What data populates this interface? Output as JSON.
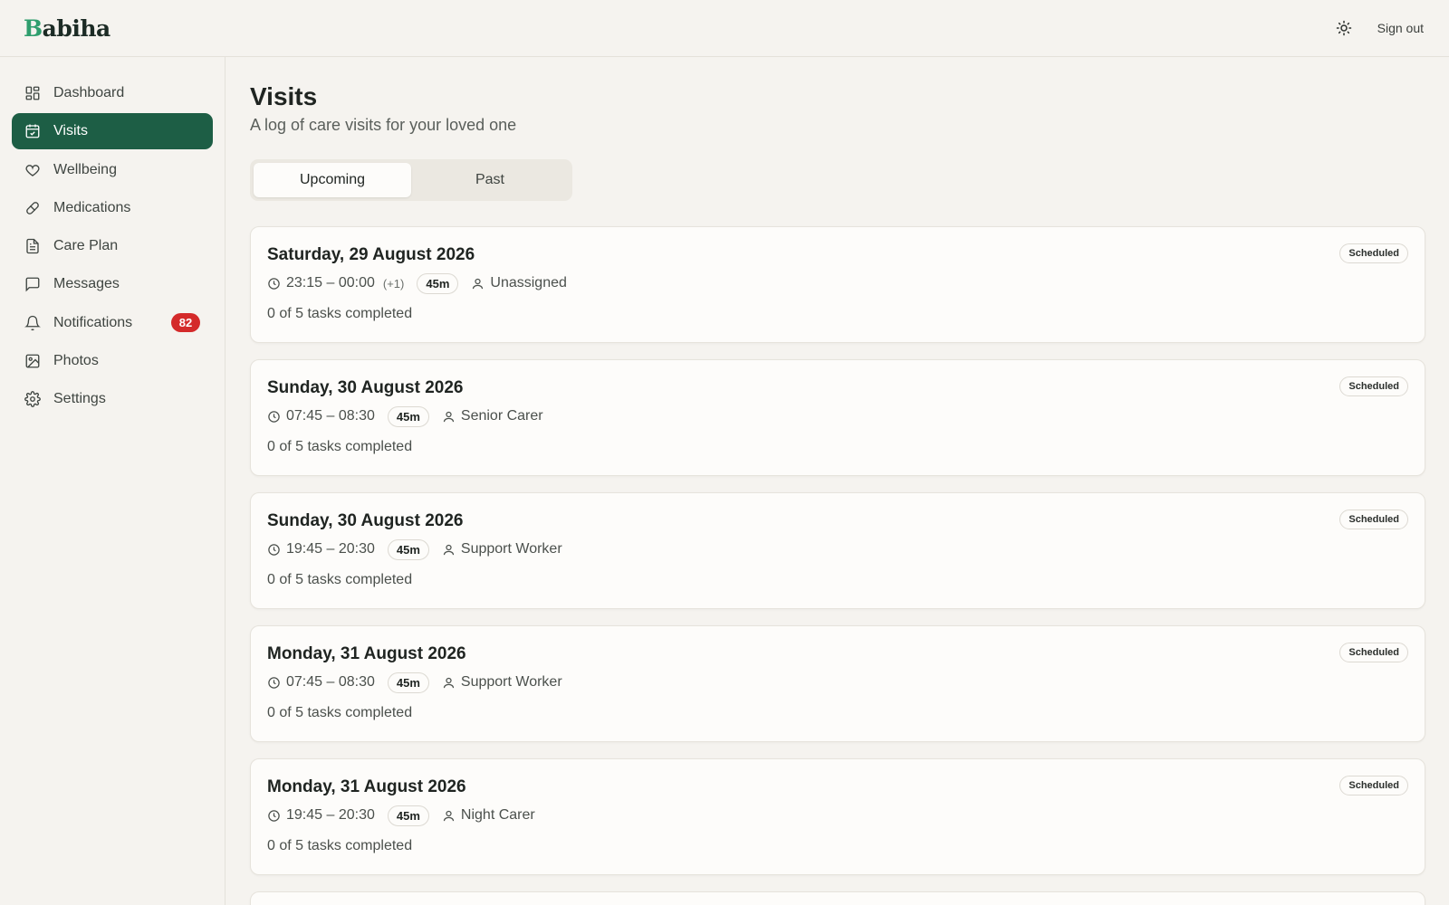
{
  "app": {
    "logo_first": "B",
    "logo_rest": "abiha",
    "sign_out": "Sign out",
    "theme_icon": "sun-icon"
  },
  "sidebar": {
    "items": [
      {
        "label": "Dashboard",
        "icon": "dashboard-icon"
      },
      {
        "label": "Visits",
        "icon": "calendar-icon",
        "active": true
      },
      {
        "label": "Wellbeing",
        "icon": "heart-icon"
      },
      {
        "label": "Medications",
        "icon": "pill-icon"
      },
      {
        "label": "Care Plan",
        "icon": "document-icon"
      },
      {
        "label": "Messages",
        "icon": "message-icon"
      },
      {
        "label": "Notifications",
        "icon": "bell-icon",
        "badge": "82"
      },
      {
        "label": "Photos",
        "icon": "image-icon"
      },
      {
        "label": "Settings",
        "icon": "gear-icon"
      }
    ]
  },
  "main": {
    "title": "Visits",
    "subtitle": "A log of care visits for your loved one",
    "tabs": [
      {
        "label": "Upcoming",
        "active": true
      },
      {
        "label": "Past"
      }
    ]
  },
  "visits": [
    {
      "date": "Saturday, 29 August 2026",
      "time": "23:15 – 00:00",
      "next_day": "(+1)",
      "duration": "45m",
      "carer": "Unassigned",
      "tasks": "0 of 5 tasks completed",
      "status": "Scheduled"
    },
    {
      "date": "Sunday, 30 August 2026",
      "time": "07:45 – 08:30",
      "duration": "45m",
      "carer": "Senior Carer",
      "tasks": "0 of 5 tasks completed",
      "status": "Scheduled"
    },
    {
      "date": "Sunday, 30 August 2026",
      "time": "19:45 – 20:30",
      "duration": "45m",
      "carer": "Support Worker",
      "tasks": "0 of 5 tasks completed",
      "status": "Scheduled"
    },
    {
      "date": "Monday, 31 August 2026",
      "time": "07:45 – 08:30",
      "duration": "45m",
      "carer": "Support Worker",
      "tasks": "0 of 5 tasks completed",
      "status": "Scheduled"
    },
    {
      "date": "Monday, 31 August 2026",
      "time": "19:45 – 20:30",
      "duration": "45m",
      "carer": "Night Carer",
      "tasks": "0 of 5 tasks completed",
      "status": "Scheduled"
    }
  ],
  "colors": {
    "accent": "#1d5e45",
    "logo_accent": "#2f9e6e",
    "badge": "#d42a2a",
    "background": "#f5f3ef"
  }
}
